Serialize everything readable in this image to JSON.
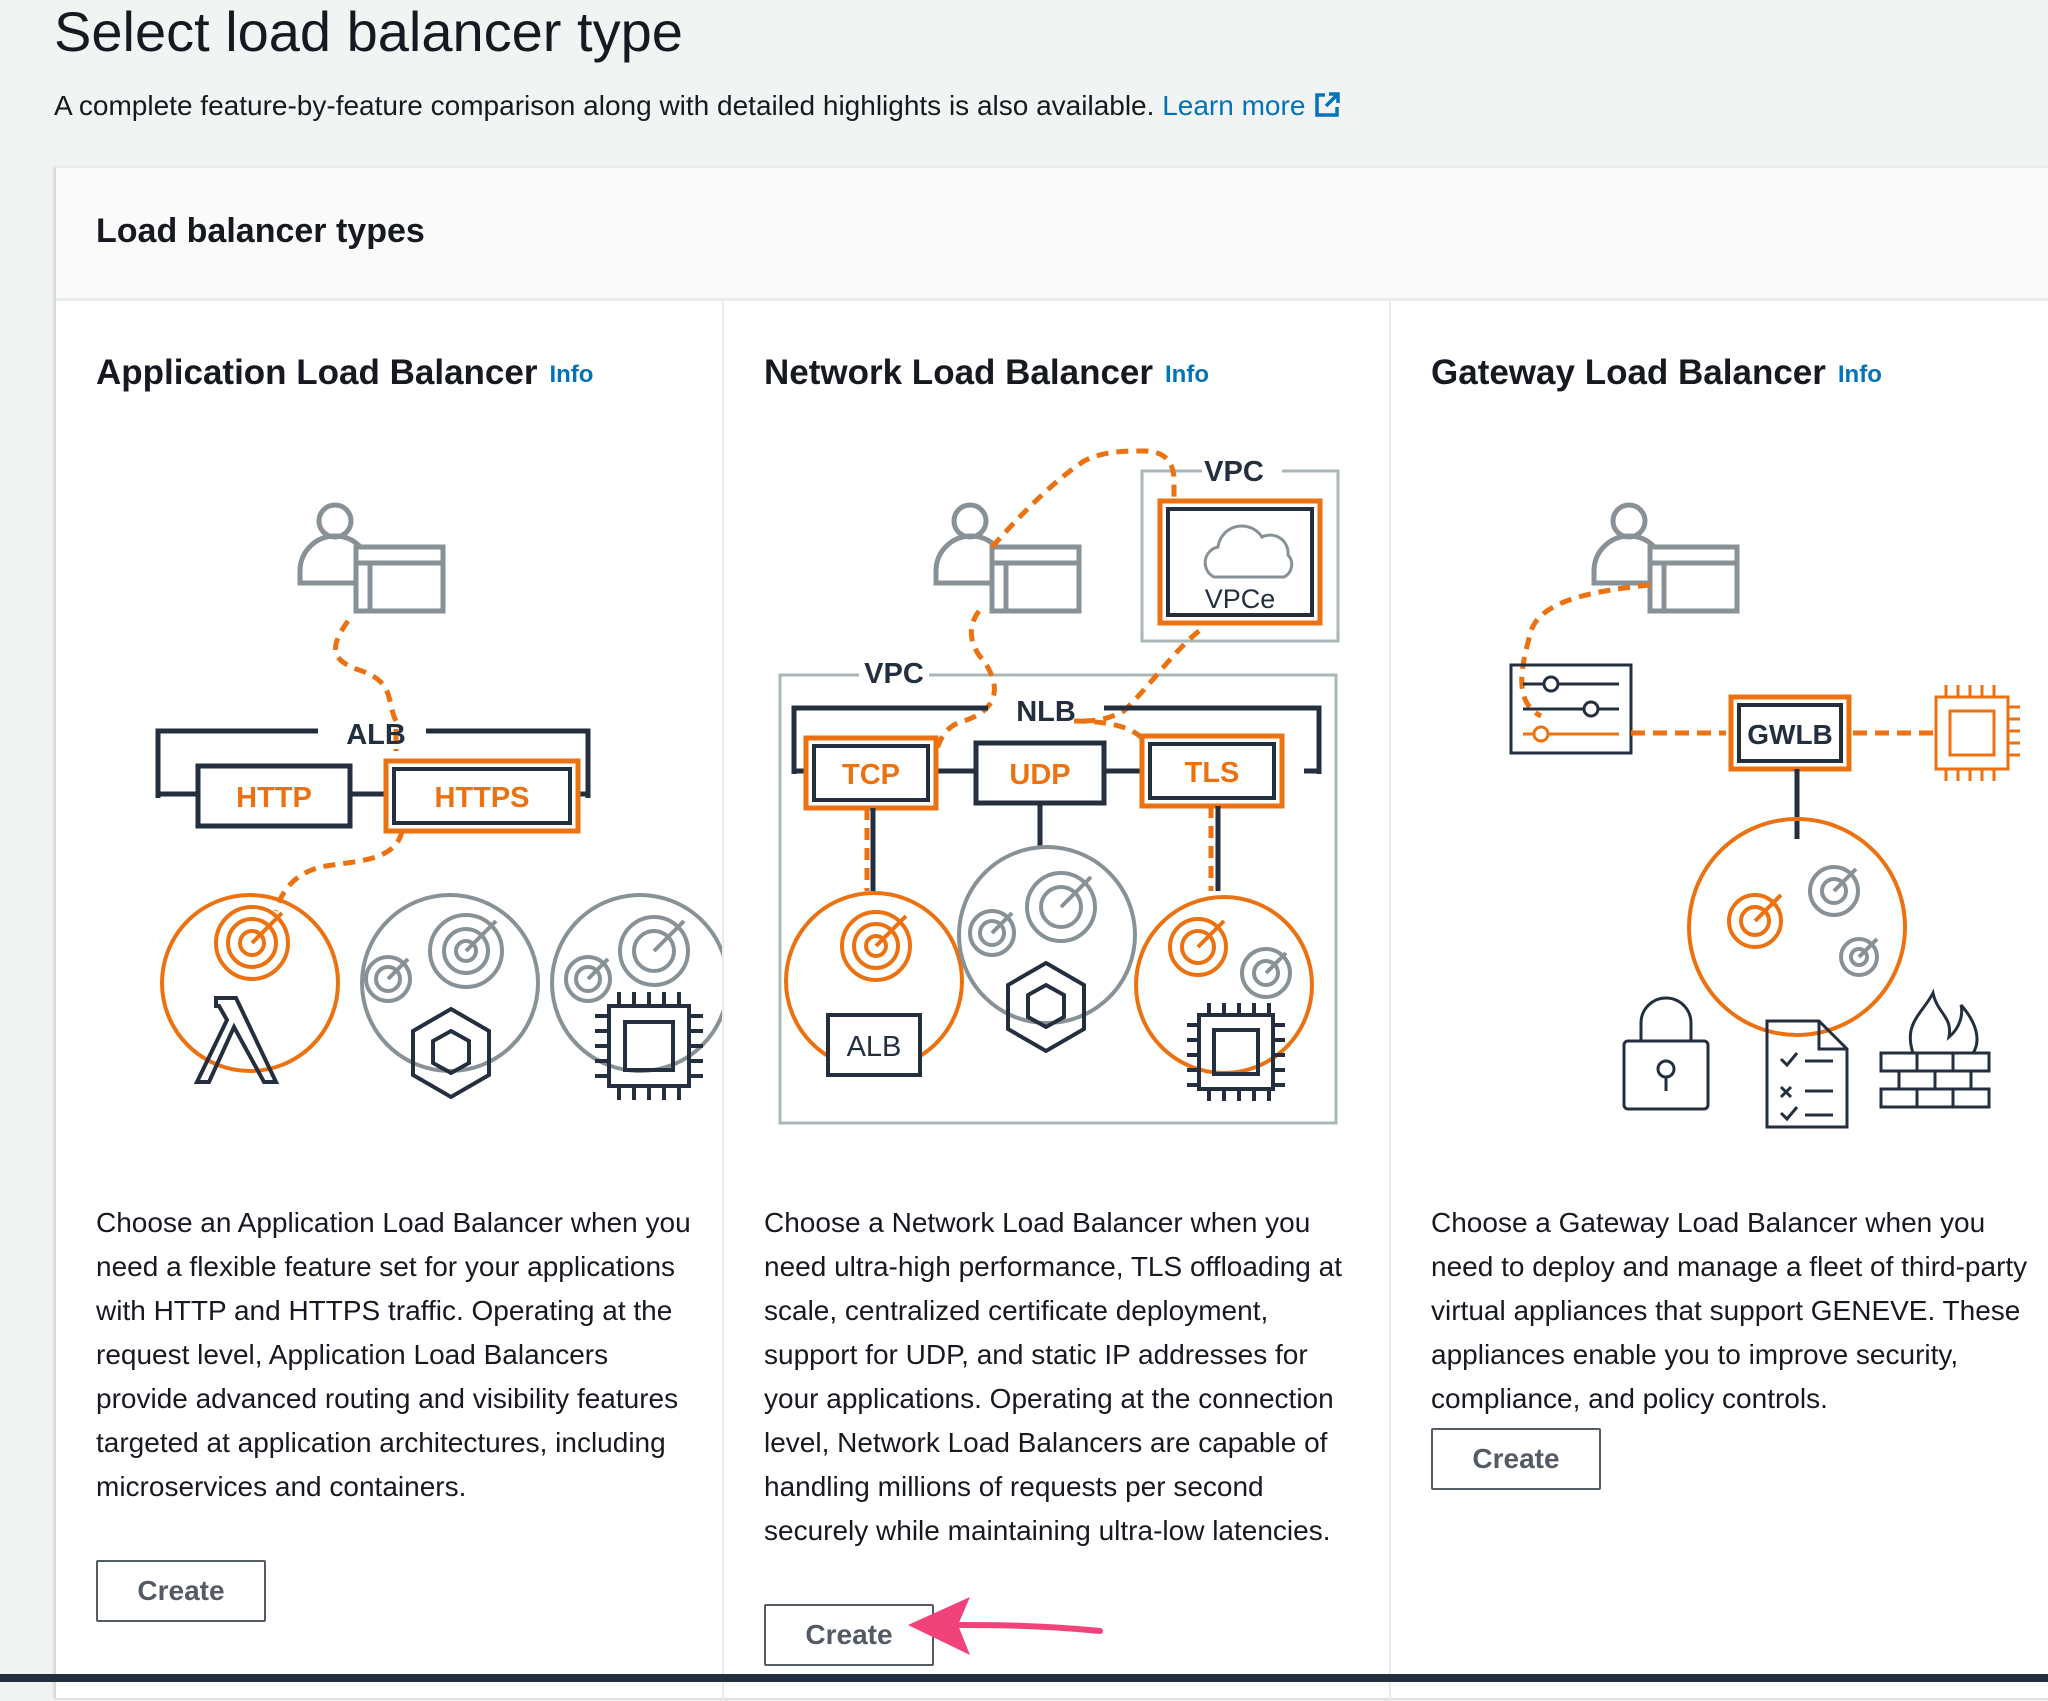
{
  "page": {
    "title": "Select load balancer type",
    "subtitle": "A complete feature-by-feature comparison along with detailed highlights is also available.",
    "learn_more": "Learn more"
  },
  "panel": {
    "title": "Load balancer types"
  },
  "cards": [
    {
      "title": "Application Load Balancer",
      "info": "Info",
      "diagram": {
        "labels": [
          "ALB",
          "HTTP",
          "HTTPS"
        ]
      },
      "description": "Choose an Application Load Balancer when you need a flexible feature set for your applications with HTTP and HTTPS traffic. Operating at the request level, Application Load Balancers provide advanced routing and visibility features targeted at application architectures, including microservices and containers.",
      "button": "Create"
    },
    {
      "title": "Network Load Balancer",
      "info": "Info",
      "diagram": {
        "labels": [
          "VPC",
          "VPCe",
          "VPC",
          "NLB",
          "TCP",
          "UDP",
          "TLS",
          "ALB"
        ]
      },
      "description": "Choose a Network Load Balancer when you need ultra-high performance, TLS offloading at scale, centralized certificate deployment, support for UDP, and static IP addresses for your applications. Operating at the connection level, Network Load Balancers are capable of handling millions of requests per second securely while maintaining ultra-low latencies.",
      "button": "Create"
    },
    {
      "title": "Gateway Load Balancer",
      "info": "Info",
      "diagram": {
        "labels": [
          "GWLB"
        ]
      },
      "description": "Choose a Gateway Load Balancer when you need to deploy and manage a fleet of third-party virtual appliances that support GENEVE. These appliances enable you to improve security, compliance, and policy controls.",
      "button": "Create"
    }
  ],
  "colors": {
    "accent": "#ec7211",
    "link": "#0073bb",
    "annotation_arrow": "#f0437a",
    "dark": "#232f3e",
    "gray": "#879196"
  }
}
